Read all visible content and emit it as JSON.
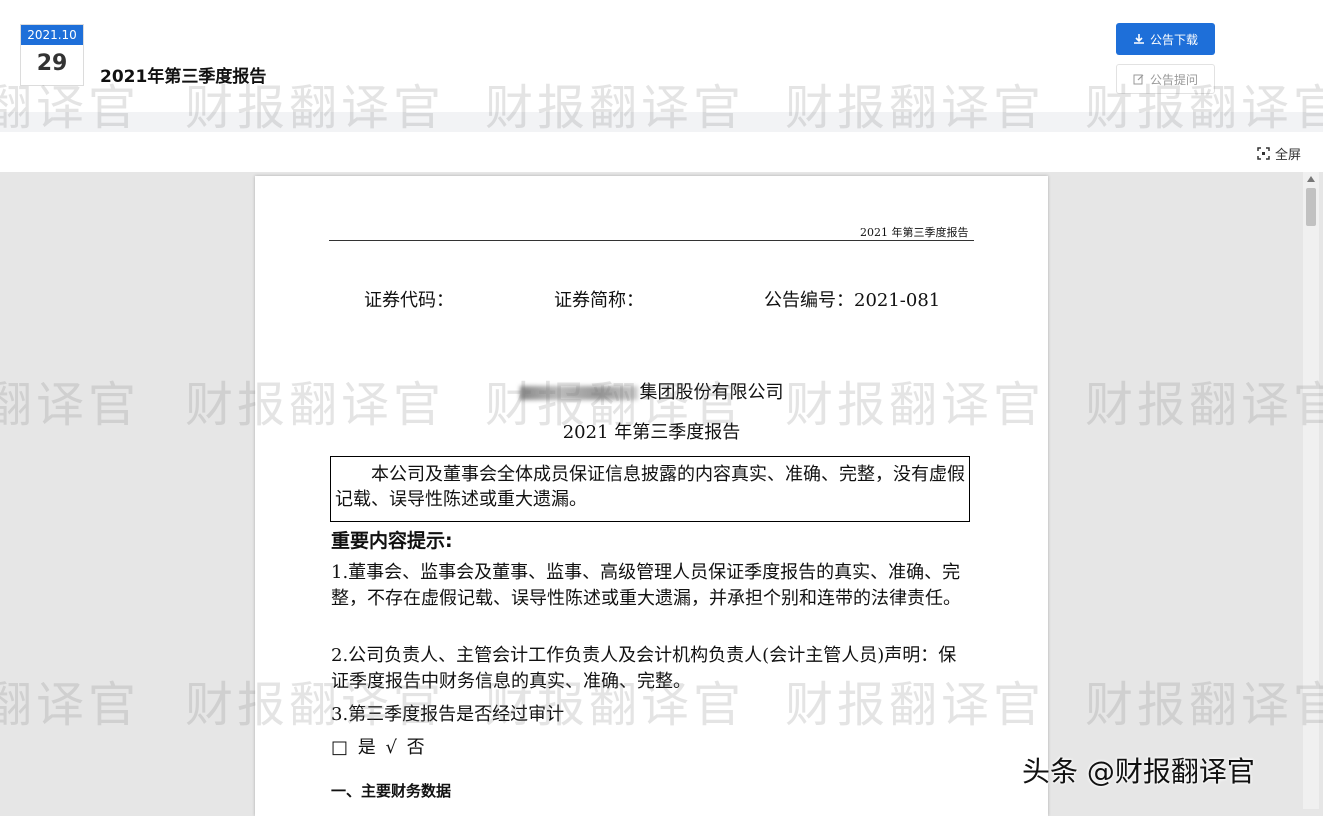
{
  "header": {
    "date_month": "2021.10",
    "date_day": "29",
    "title": "2021年第三季度报告",
    "download_label": "公告下载",
    "ask_label": "公告提问",
    "accent_color": "#1e6fd9"
  },
  "toolbar": {
    "fullscreen_label": "全屏"
  },
  "document": {
    "running_head": "2021 年第三季度报告",
    "security_code_label": "证券代码：",
    "security_name_label": "证券简称：",
    "announcement_no": "公告编号：2021-081",
    "company_name": "集团股份有限公司",
    "report_title": "2021 年第三季度报告",
    "notice": "本公司及董事会全体成员保证信息披露的内容真实、准确、完整，没有虚假记载、误导性陈述或重大遗漏。",
    "important_title": "重要内容提示:",
    "item1": "1.董事会、监事会及董事、监事、高级管理人员保证季度报告的真实、准确、完整，不存在虚假记载、误导性陈述或重大遗漏，并承担个别和连带的法律责任。",
    "item2": "2.公司负责人、主管会计工作负责人及会计机构负责人(会计主管人员)声明：保证季度报告中财务信息的真实、准确、完整。",
    "item3": "3.第三季度报告是否经过审计",
    "audit_options": "□ 是 √ 否",
    "financial_section_title": "一、主要财务数据"
  },
  "watermark": {
    "text": "财报翻译官",
    "corner_text": "头条 @财报翻译官"
  }
}
